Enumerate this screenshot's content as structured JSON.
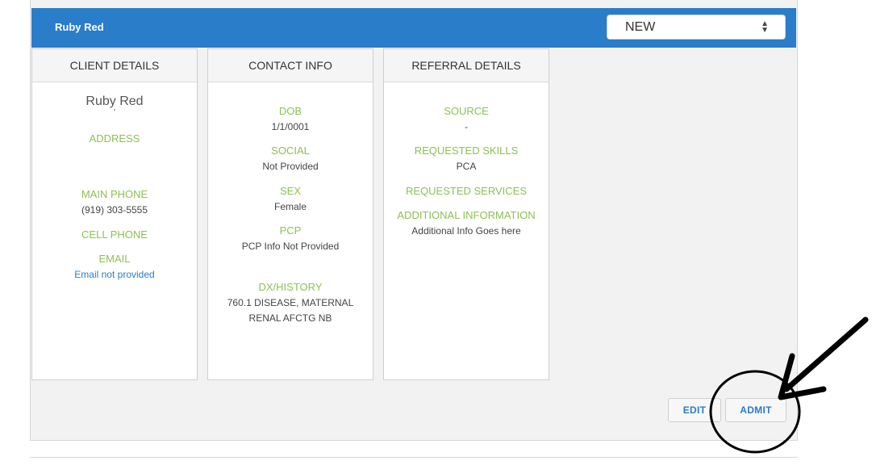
{
  "client": {
    "name": "Ruby Red"
  },
  "status_select": {
    "value": "NEW",
    "arrows": "▲▼"
  },
  "cards": {
    "client_details": {
      "header": "CLIENT DETAILS",
      "name": "Ruby Red",
      "name_sub": "'",
      "address_label": "ADDRESS",
      "main_phone_label": "MAIN PHONE",
      "main_phone": "(919) 303-5555",
      "cell_phone_label": "CELL PHONE",
      "email_label": "EMAIL",
      "email": "Email not provided"
    },
    "contact_info": {
      "header": "CONTACT INFO",
      "dob_label": "DOB",
      "dob": "1/1/0001",
      "social_label": "SOCIAL",
      "social": "Not Provided",
      "sex_label": "SEX",
      "sex": "Female",
      "pcp_label": "PCP",
      "pcp": "PCP Info Not Provided",
      "dx_label": "DX/HISTORY",
      "dx_line1": "760.1 DISEASE, MATERNAL",
      "dx_line2": "RENAL AFCTG NB"
    },
    "referral_details": {
      "header": "REFERRAL DETAILS",
      "source_label": "SOURCE",
      "source": "-",
      "skills_label": "REQUESTED SKILLS",
      "skills": "PCA",
      "services_label": "REQUESTED SERVICES",
      "additional_label": "ADDITIONAL INFORMATION",
      "additional": "Additional Info Goes here"
    }
  },
  "actions": {
    "edit": "EDIT",
    "admit": "ADMIT"
  },
  "colors": {
    "accent": "#2a7dc9",
    "label_green": "#8cc152"
  }
}
